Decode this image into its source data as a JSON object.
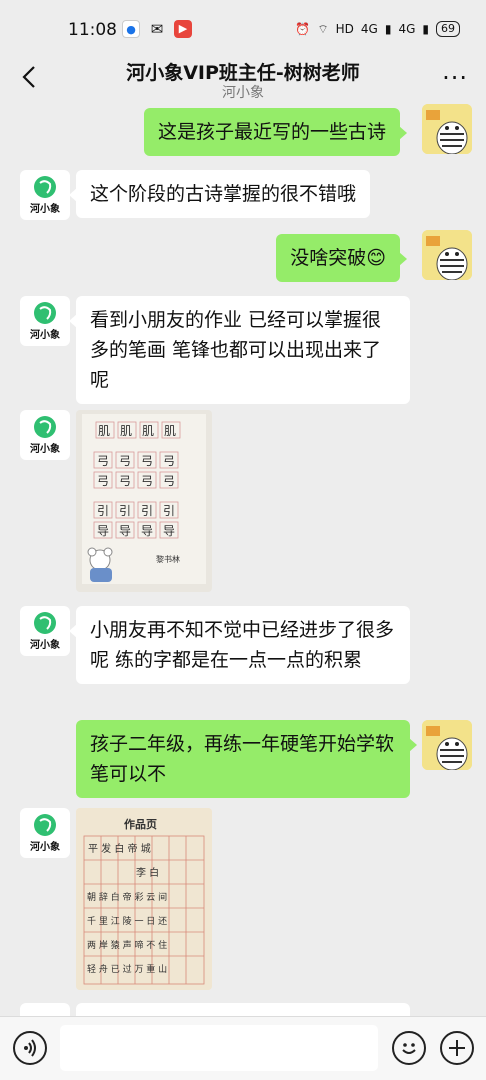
{
  "status_bar": {
    "time": "11:08",
    "network": "HD",
    "signal_1": "4G",
    "signal_2": "4G",
    "battery": "69"
  },
  "header": {
    "title": "河小象VIP班主任-树树老师",
    "subtitle": "河小象"
  },
  "brand_avatar_text": "河小象",
  "messages": [
    {
      "side": "out",
      "text": "这是孩子最近写的一些古诗"
    },
    {
      "side": "in",
      "text": "这个阶段的古诗掌握的很不错哦"
    },
    {
      "side": "out",
      "text": "没啥突破😊"
    },
    {
      "side": "in",
      "text": "看到小朋友的作业 已经可以掌握很多的笔画 笔锋也都可以出现出来了呢"
    },
    {
      "side": "in",
      "type": "image",
      "image_text": [
        "肌",
        "弓",
        "引",
        "导"
      ],
      "signature": "黎书林"
    },
    {
      "side": "in",
      "text": "小朋友再不知不觉中已经进步了很多呢 练的字都是在一点一点的积累"
    },
    {
      "side": "out",
      "text": "孩子二年级，再练一年硬笔开始学软笔可以不"
    },
    {
      "side": "in",
      "type": "image",
      "image_title": "作品页",
      "poem_lines": [
        "平 发 白 帝 城",
        "李 白",
        "朝 辞 白 帝 彩 云 间",
        "千 里 江 陵 一 日 还",
        "两 岸 猿 声 啼 不 住",
        "轻 舟 已 过 万 重 山"
      ]
    }
  ],
  "input": {
    "placeholder": ""
  },
  "colors": {
    "bg": "#ededed",
    "out_bubble": "#95ec69",
    "in_bubble": "#ffffff",
    "brand_green": "#2fbf71"
  }
}
